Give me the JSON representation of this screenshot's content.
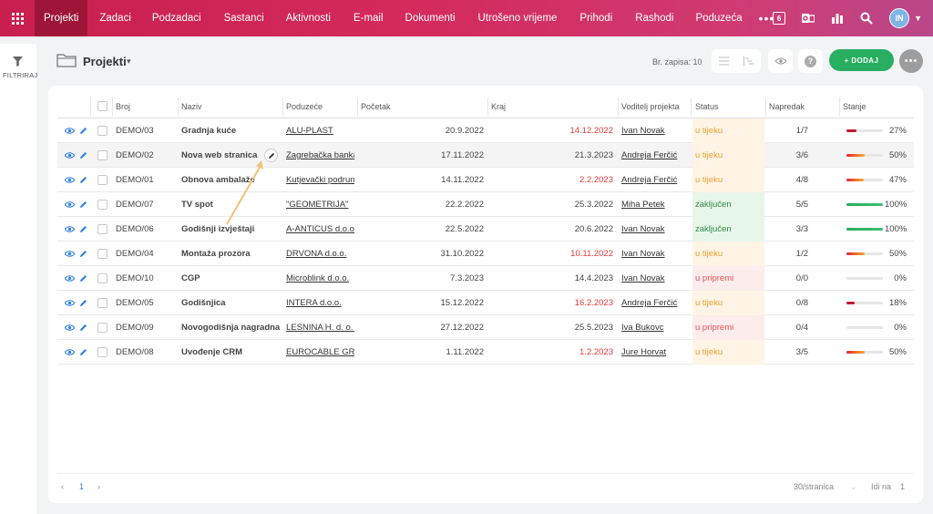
{
  "nav": {
    "items": [
      "Projekti",
      "Zadaci",
      "Podzadaci",
      "Sastanci",
      "Aktivnosti",
      "E-mail",
      "Dokumenti",
      "Utrošeno vrijeme",
      "Prihodi",
      "Rashodi",
      "Poduzeća"
    ],
    "more": "•••",
    "calendar_day": "6",
    "avatar_initials": "IN"
  },
  "sidebar": {
    "filter_label": "FILTRIRAJ"
  },
  "header": {
    "title": "Projekti",
    "record_count": "Br. zapisa: 10",
    "add_label": "+ DODAJ",
    "more_label": "•••"
  },
  "table": {
    "columns": {
      "broj": "Broj",
      "naziv": "Naziv",
      "poduzece": "Poduzeće",
      "pocetak": "Početak",
      "kraj": "Kraj",
      "voda": "Voditelj projekta",
      "status": "Status",
      "napredak": "Napredak",
      "stanje": "Stanje"
    },
    "rows": [
      {
        "broj": "DEMO/03",
        "naziv": "Gradnja kuće",
        "poduzece": "ALU-PLAST",
        "pocetak": "20.9.2022",
        "kraj": "14.12.2022",
        "late": true,
        "voda": "Ivan Novak",
        "status": "u tijeku",
        "st": "u",
        "napredak": "1/7",
        "pct": "27%",
        "fill": 0.27
      },
      {
        "broj": "DEMO/02",
        "naziv": "Nova web stranica",
        "poduzece": "Zagrebačka banka",
        "pocetak": "17.11.2022",
        "kraj": "21.3.2023",
        "late": false,
        "voda": "Andreja Ferčić",
        "status": "u tijeku",
        "st": "u",
        "napredak": "3/6",
        "pct": "50%",
        "fill": 0.5
      },
      {
        "broj": "DEMO/01",
        "naziv": "Obnova ambalaže",
        "poduzece": "Kutjevački podrum",
        "pocetak": "14.11.2022",
        "kraj": "2.2.2023",
        "late": true,
        "voda": "Andreja Ferčić",
        "status": "u tijeku",
        "st": "u",
        "napredak": "4/8",
        "pct": "47%",
        "fill": 0.47
      },
      {
        "broj": "DEMO/07",
        "naziv": "TV spot",
        "poduzece": "\"GEOMETRIJA\"",
        "pocetak": "22.2.2022",
        "kraj": "25.3.2022",
        "late": false,
        "voda": "Miha Petek",
        "status": "zaključen",
        "st": "z",
        "napredak": "5/5",
        "pct": "100%",
        "fill": 1
      },
      {
        "broj": "DEMO/06",
        "naziv": "Godišnji izvještaji",
        "poduzece": "A-ANTICUS d.o.o.",
        "pocetak": "22.5.2022",
        "kraj": "20.6.2022",
        "late": false,
        "voda": "Ivan Novak",
        "status": "zaključen",
        "st": "z",
        "napredak": "3/3",
        "pct": "100%",
        "fill": 1
      },
      {
        "broj": "DEMO/04",
        "naziv": "Montaža prozora",
        "poduzece": "DRVONA d.o.o.",
        "pocetak": "31.10.2022",
        "kraj": "10.11.2022",
        "late": true,
        "voda": "Ivan Novak",
        "status": "u tijeku",
        "st": "u",
        "napredak": "1/2",
        "pct": "50%",
        "fill": 0.5
      },
      {
        "broj": "DEMO/10",
        "naziv": "CGP",
        "poduzece": "Microblink d.o.o.",
        "pocetak": "7.3.2023",
        "kraj": "14.4.2023",
        "late": false,
        "voda": "Ivan Novak",
        "status": "u pripremi",
        "st": "p",
        "napredak": "0/0",
        "pct": "0%",
        "fill": 0
      },
      {
        "broj": "DEMO/05",
        "naziv": "Godišnjica",
        "poduzece": "INTERA d.o.o.",
        "pocetak": "15.12.2022",
        "kraj": "16.2.2023",
        "late": true,
        "voda": "Andreja Ferčić",
        "status": "u tijeku",
        "st": "u",
        "napredak": "0/8",
        "pct": "18%",
        "fill": 0.18
      },
      {
        "broj": "DEMO/09",
        "naziv": "Novogodišnja nagradna igra",
        "poduzece": "LESNINA H. d. o. o.",
        "pocetak": "27.12.2022",
        "kraj": "25.5.2023",
        "late": false,
        "voda": "Iva Bukovc",
        "status": "u pripremi",
        "st": "p",
        "napredak": "0/4",
        "pct": "0%",
        "fill": 0
      },
      {
        "broj": "DEMO/08",
        "naziv": "Uvođenje CRM",
        "poduzece": "EUROCABLE GROUP",
        "pocetak": "1.11.2022",
        "kraj": "1.2.2023",
        "late": true,
        "voda": "Jure Horvat",
        "status": "u tijeku",
        "st": "u",
        "napredak": "3/5",
        "pct": "50%",
        "fill": 0.5
      }
    ]
  },
  "pagination": {
    "prev": "‹",
    "page": "1",
    "next": "›",
    "per_page": "30/stranica",
    "goto_label": "Idi na",
    "goto_value": "1"
  },
  "colors": {
    "brand": "#d42a5c",
    "add": "#27ae60",
    "late": "#e53935",
    "done": "#27ae60"
  }
}
